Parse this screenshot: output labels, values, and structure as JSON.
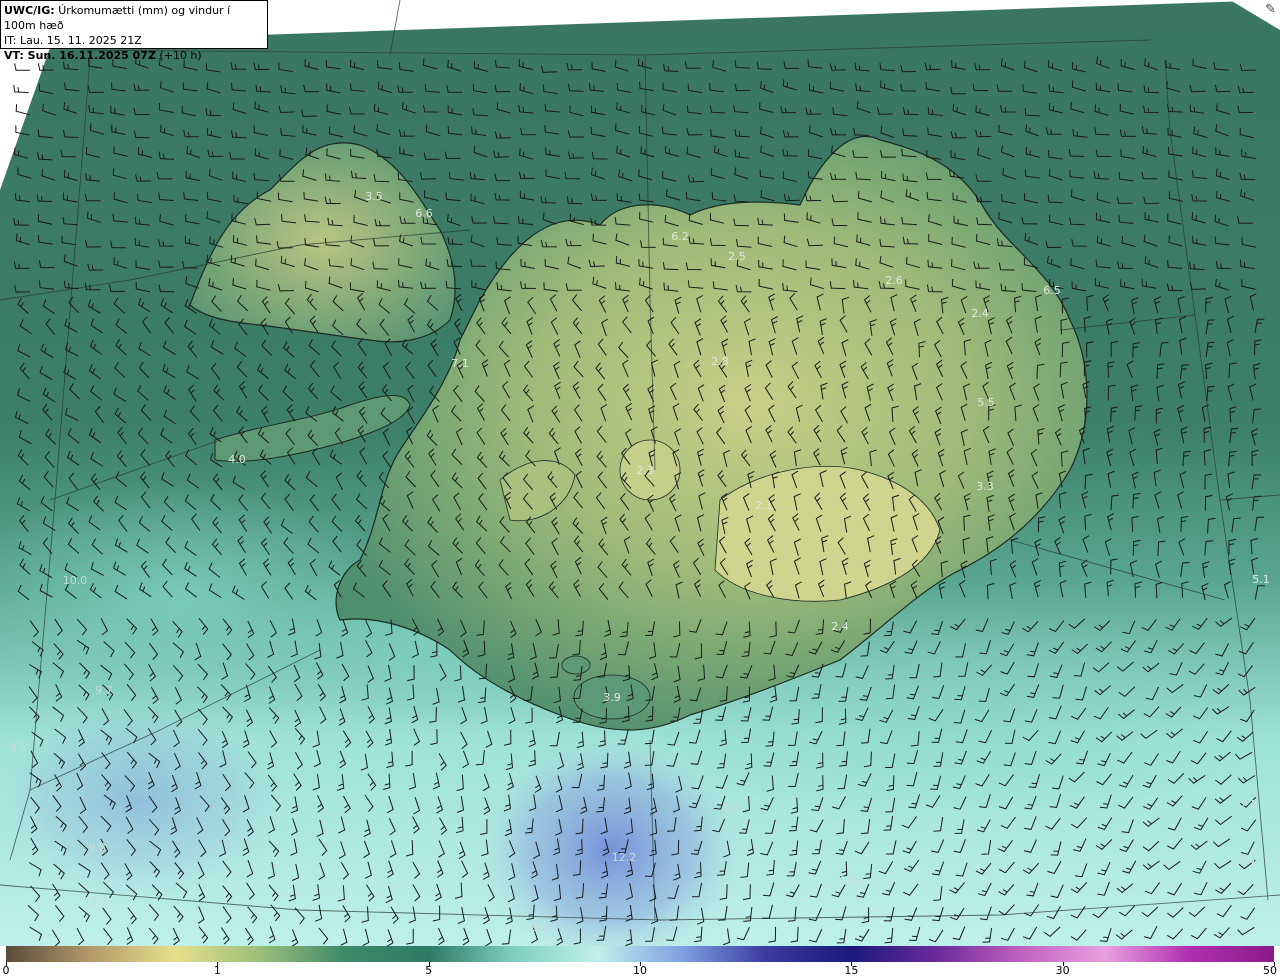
{
  "header": {
    "product": "UWC/IG:",
    "title": "Úrkomumætti (mm) og vindur í 100m hæð",
    "it": "IT: Lau. 15. 11. 2025 21Z",
    "vt_prefix": "VT: Sun. 16.11.2025 07Z",
    "vt_suffix": " (+10 h)"
  },
  "corner_icon": "pen-icon",
  "value_labels": [
    {
      "text": "3.5",
      "pos": [
        374,
        196
      ],
      "color": "#e0e8e0"
    },
    {
      "text": "6.6",
      "pos": [
        424,
        213
      ],
      "color": "#e0e8e0"
    },
    {
      "text": "6.2",
      "pos": [
        680,
        236
      ],
      "color": "#e0e8e0"
    },
    {
      "text": "2.5",
      "pos": [
        737,
        256
      ],
      "color": "#e0e8e0"
    },
    {
      "text": "2.6",
      "pos": [
        894,
        280
      ],
      "color": "#e0e8e0"
    },
    {
      "text": "6.5",
      "pos": [
        1052,
        290
      ],
      "color": "#e0e8e0"
    },
    {
      "text": "2.4",
      "pos": [
        980,
        313
      ],
      "color": "#e0e8e0"
    },
    {
      "text": "2.8",
      "pos": [
        720,
        361
      ],
      "color": "#e0e8e0"
    },
    {
      "text": "7.1",
      "pos": [
        460,
        363
      ],
      "color": "#e0e8e0"
    },
    {
      "text": "5.5",
      "pos": [
        986,
        402
      ],
      "color": "#e0e8e0"
    },
    {
      "text": "4.0",
      "pos": [
        237,
        459
      ],
      "color": "#e0e8e0"
    },
    {
      "text": "2.3",
      "pos": [
        645,
        470
      ],
      "color": "#e0e8e0"
    },
    {
      "text": "3.3",
      "pos": [
        985,
        486
      ],
      "color": "#e0e8e0"
    },
    {
      "text": "2.1",
      "pos": [
        764,
        505
      ],
      "color": "#e0e8e0"
    },
    {
      "text": "10.0",
      "pos": [
        75,
        580
      ],
      "color": "#c9dcd6"
    },
    {
      "text": "5.1",
      "pos": [
        1261,
        579
      ],
      "color": "#e0e8e0"
    },
    {
      "text": "2.4",
      "pos": [
        840,
        626
      ],
      "color": "#e0e8e0"
    },
    {
      "text": "9.7",
      "pos": [
        104,
        690
      ],
      "color": "#c9dcd6"
    },
    {
      "text": "3.9",
      "pos": [
        612,
        697
      ],
      "color": "#e0e8e0"
    },
    {
      "text": "9.5",
      "pos": [
        18,
        747
      ],
      "color": "#c9dcd6"
    },
    {
      "text": "9.9",
      "pos": [
        731,
        808
      ],
      "color": "#c9dcd6"
    },
    {
      "text": "7.5",
      "pos": [
        1249,
        804
      ],
      "color": "#c9dcd6"
    },
    {
      "text": "9.8",
      "pos": [
        97,
        847
      ],
      "color": "#c9dcd6"
    },
    {
      "text": "12.2",
      "pos": [
        624,
        857
      ],
      "color": "#c9dcd6"
    },
    {
      "text": "7.1",
      "pos": [
        1248,
        859
      ],
      "color": "#c9dcd6"
    },
    {
      "text": "10.4",
      "pos": [
        852,
        880
      ],
      "color": "#c9dcd6"
    },
    {
      "text": "11.1",
      "pos": [
        96,
        901
      ],
      "color": "#c9dcd6"
    },
    {
      "text": "9.9",
      "pos": [
        540,
        927
      ],
      "color": "#c9dcd6"
    }
  ],
  "colorbar": {
    "ticks": [
      {
        "label": "0",
        "frac": 0.0
      },
      {
        "label": "1",
        "frac": 0.1667
      },
      {
        "label": "5",
        "frac": 0.3333
      },
      {
        "label": "10",
        "frac": 0.5
      },
      {
        "label": "15",
        "frac": 0.6667
      },
      {
        "label": "30",
        "frac": 0.8333
      },
      {
        "label": "50",
        "frac": 1.0
      }
    ],
    "stops": [
      "#5a4a3a",
      "#b39a6a",
      "#e6e08a",
      "#9bbf7a",
      "#3f8a6a",
      "#2f7a65",
      "#7fcfbf",
      "#bff0ea",
      "#7fa0e0",
      "#3a3aa0",
      "#1a1a7a",
      "#6a2a9a",
      "#c060c0",
      "#e8a0e0",
      "#b030b0",
      "#8a1a8a"
    ]
  },
  "colors": {
    "sea_north": "#3e7c66",
    "sea_south": "#a6e6de",
    "land_low": "#4f9270",
    "land_high": "#cfd48c",
    "coast": "#1a2a24"
  }
}
